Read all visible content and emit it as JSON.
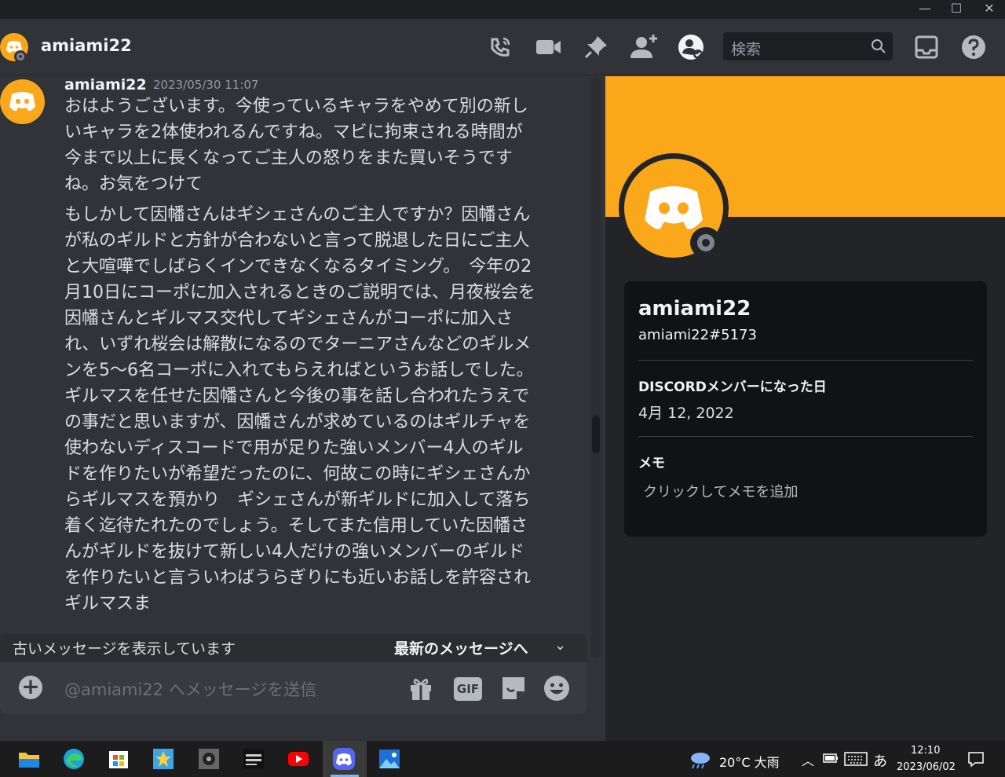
{
  "window": {
    "minimize_glyph": "—",
    "maximize_glyph": "☐",
    "close_glyph": "✕"
  },
  "header": {
    "channel_name": "amiami22",
    "icons": [
      "call-icon",
      "video-icon",
      "pin-icon",
      "add-friend-icon",
      "profile-toggle-icon",
      "inbox-icon",
      "help-icon"
    ],
    "search_placeholder": "検索"
  },
  "message": {
    "author": "amiami22",
    "timestamp": "2023/05/30 11:07",
    "paragraphs": [
      "おはようございます。今使っているキャラをやめて別の新しいキャラを2体使われるんですね。マビに拘束される時間が今まで以上に長くなってご主人の怒りをまた買いそうですね。お気をつけて",
      "もしかして因幡さんはギシェさんのご主人ですか？因幡さんが私のギルドと方針が合わないと言って脱退した日にご主人と大喧嘩でしばらくインできなくなるタイミング。　今年の2月10日にコーポに加入されるときのご説明では、月夜桜会を因幡さんとギルマス交代してギシェさんがコーポに加入され、いずれ桜会は解散になるのでターニアさんなどのギルメンを5〜6名コーポに入れてもらえればというお話しでした。　ギルマスを任せた因幡さんと今後の事を話し合われたうえでの事だと思いますが、因幡さんが求めているのはギルチャを使わないディスコードで用が足りた強いメンバー4人のギルドを作りたいが希望だったのに、何故この時にギシェさんからギルマスを預かり　ギシェさんが新ギルドに加入して落ち着く迄待たれたのでしょう。そしてまた信用していた因幡さんがギルドを抜けて新しい4人だけの強いメンバーのギルドを作りたいと言ういわばうらぎりにも近いお話しを許容されギルマスま"
    ]
  },
  "jump_bar": {
    "left_text": "古いメッセージを表示しています",
    "right_text": "最新のメッセージへ",
    "chevron": "⌄"
  },
  "composer": {
    "placeholder": "@amiami22 へメッセージを送信",
    "gif_label": "GIF"
  },
  "profile": {
    "display_name": "amiami22",
    "tag": "amiami22#5173",
    "member_since_heading": "DISCORDメンバーになった日",
    "member_since_value": "4月 12, 2022",
    "note_heading": "メモ",
    "note_placeholder": "クリックしてメモを追加",
    "accent_color": "#faa81a"
  },
  "taskbar": {
    "apps": [
      "file-explorer-icon",
      "edge-icon",
      "store-icon",
      "star-app-icon",
      "puzzle-app-icon",
      "wiki-app-icon",
      "youtube-icon",
      "discord-icon",
      "photos-icon"
    ],
    "weather": "20°C  大雨",
    "ime": "あ",
    "time": "12:10",
    "date": "2023/06/02"
  }
}
